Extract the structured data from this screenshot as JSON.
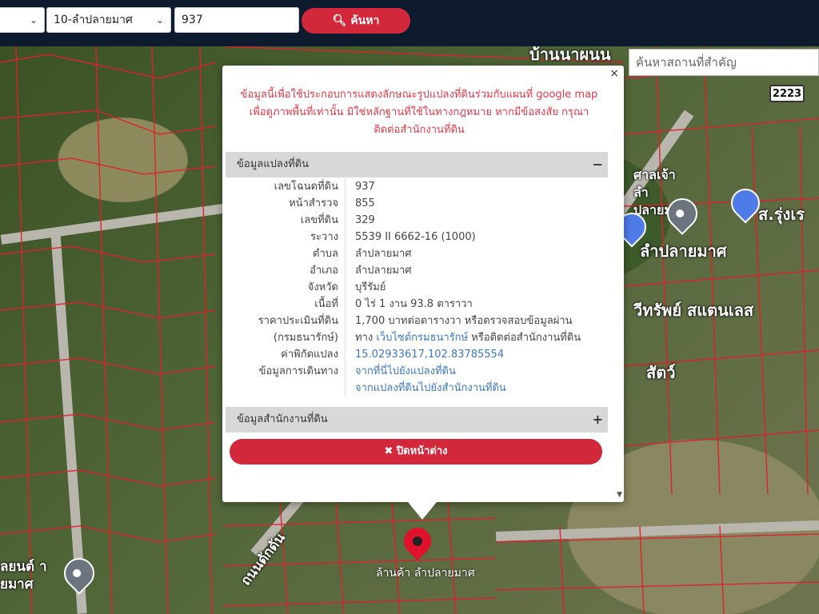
{
  "topbar": {
    "select1_value": "",
    "select2_value": "10-ลำปลายมาศ",
    "deed_input_value": "937",
    "search_button_label": "ค้นหา"
  },
  "map": {
    "search_place_placeholder": "ค้นหาสถานที่สำคัญ",
    "route_number": "2223",
    "labels": [
      "บ้านนาผนน",
      "ลำปลายมาศ",
      "วีทรัพย์ สแตนเลส",
      "ถนนดักดัน",
      "ลยนต์ ายมาศ",
      "ศาลเจ้า ลำปลายมาศ",
      "สัตว์",
      "ส.รุ่งเร",
      "ล้านค้า ลำปลายมาศ"
    ]
  },
  "popup": {
    "close_glyph": "×",
    "notice_line1": "ข้อมูลนี้เพื่อใช้ประกอบการแสดงลักษณะรูปแปลงที่ดินร่วมกับแผนที่ google map",
    "notice_line2": "เพื่อดูภาพพื้นที่เท่านั้น มิใช่หลักฐานที่ใช้ในทางกฎหมาย หากมีข้อสงสัย กรุณา",
    "notice_line3": "ติดต่อสำนักงานที่ดิน",
    "section1_title": "ข้อมูลแปลงที่ดิน",
    "section1_toggle": "−",
    "rows": [
      {
        "label": "เลขโฉนดที่ดิน",
        "value": "937"
      },
      {
        "label": "หน้าสำรวจ",
        "value": "855"
      },
      {
        "label": "เลขที่ดิน",
        "value": "329"
      },
      {
        "label": "ระวาง",
        "value": "5539 II 6662-16 (1000)"
      },
      {
        "label": "ตำบล",
        "value": "ลำปลายมาศ"
      },
      {
        "label": "อำเภอ",
        "value": "ลำปลายมาศ"
      },
      {
        "label": "จังหวัด",
        "value": "บุรีรัมย์"
      },
      {
        "label": "เนื้อที่",
        "value": "0 ไร่ 1 งาน 93.8 ตาราวา"
      }
    ],
    "price_label": "ราคาประเมินที่ดิน",
    "price_value": "1,700 บาทต่อตารางวา หรือตรวจสอบข้อมูลผ่าน",
    "price_label2": "(กรมธนารักษ์)",
    "price_prefix": "ทาง",
    "price_link": "เว็บไซต์กรมธนารักษ์",
    "price_suffix": "หรือติดต่อสำนักงานที่ดิน",
    "coord_label": "ค่าพิกัดแปลง",
    "coord_value": "15.02933617,102.83785554",
    "travel_label": "ข้อมูลการเดินทาง",
    "travel_link1": "จากที่นี่ไปยังแปลงที่ดิน",
    "travel_link2": "จากแปลงที่ดินไปยังสำนักงานที่ดิน",
    "section2_title": "ข้อมูลสำนักงานที่ดิน",
    "section2_toggle": "+",
    "close_button_label": "✖ ปิดหน้าต่าง"
  },
  "colors": {
    "accent_red": "#d3283b",
    "link_blue": "#3a78c2",
    "topbar_navy": "#0e1a2e"
  }
}
